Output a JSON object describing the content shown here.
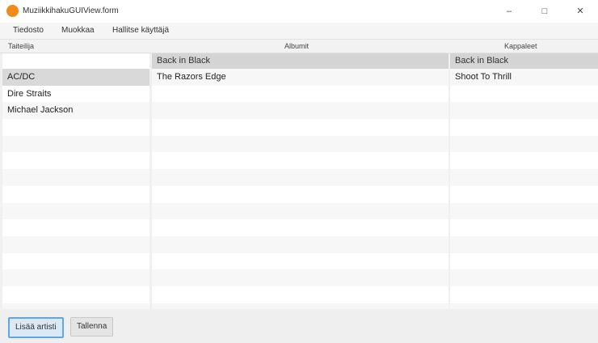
{
  "window": {
    "title": "MuziikkihakuGUIView.form",
    "controls": {
      "minimize": "–",
      "maximize": "□",
      "close": "✕"
    },
    "icon_color": "#f08a1a"
  },
  "menubar": {
    "items": [
      "Tiedosto",
      "Muokkaa",
      "Hallitse käyttäjä"
    ]
  },
  "column_headers": {
    "artist": "Taiteilija",
    "album": "Albumit",
    "songs": "Kappaleet"
  },
  "artists": {
    "items": [
      "AC/DC",
      "Dire Straits",
      "Michael Jackson"
    ],
    "selected_index": 0
  },
  "albums": {
    "header": "Back in Black",
    "items": [
      "The Razors Edge"
    ]
  },
  "songs": {
    "header": "Back in Black",
    "items": [
      "Shoot To Thrill"
    ]
  },
  "buttons": {
    "primary": "Lisää artisti",
    "secondary": "Tallenna"
  }
}
